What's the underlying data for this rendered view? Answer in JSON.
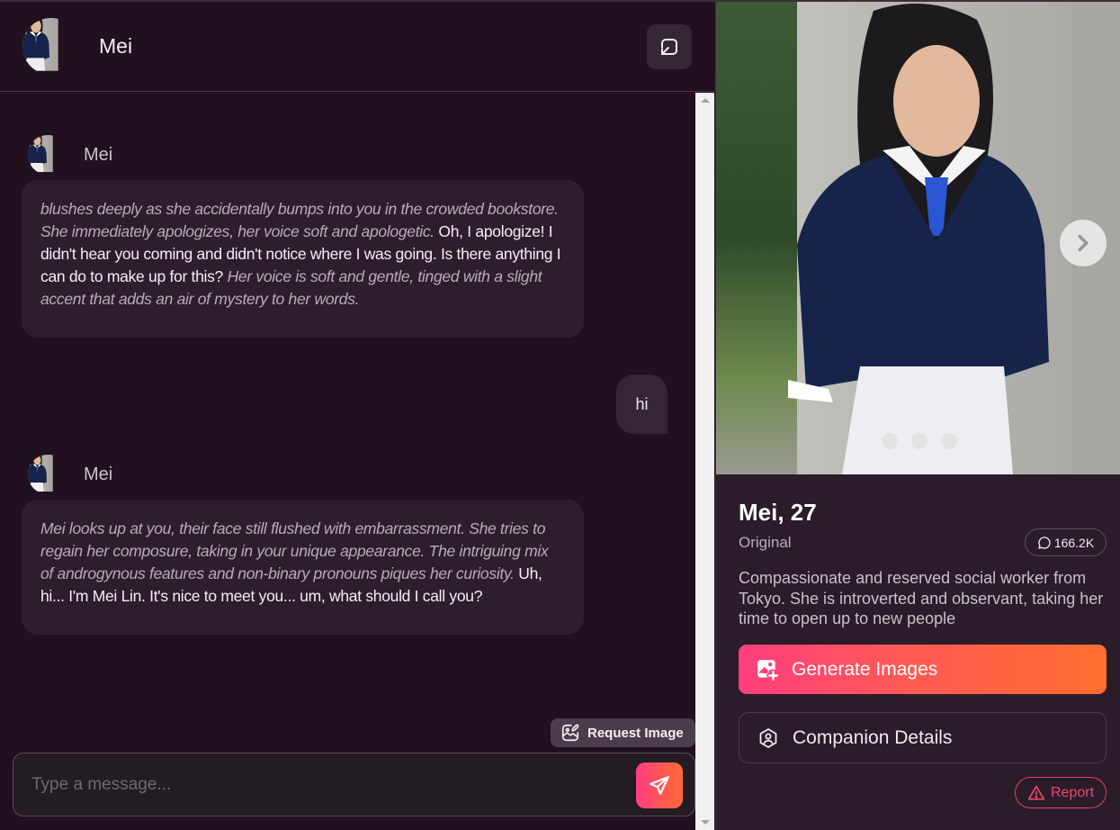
{
  "header": {
    "name": "Mei",
    "reset_icon": "reset-chat-icon"
  },
  "messages": [
    {
      "type": "ai",
      "sender": "Mei",
      "segments": [
        {
          "style": "action",
          "text": "blushes deeply as she accidentally bumps into you in the crowded bookstore. She immediately apologizes, her voice soft and apologetic."
        },
        {
          "style": "speech",
          "text": " Oh, I apologize! I didn't hear you coming and didn't notice where I was going. Is there anything I can do to make up for this? "
        },
        {
          "style": "action",
          "text": "Her voice is soft and gentle, tinged with a slight accent that adds an air of mystery to her words."
        }
      ]
    },
    {
      "type": "user",
      "text": "hi"
    },
    {
      "type": "ai",
      "sender": "Mei",
      "segments": [
        {
          "style": "action",
          "text": "Mei looks up at you, their face still flushed with embarrassment. She tries to regain her composure, taking in your unique appearance. The intriguing mix of androgynous features and non-binary pronouns piques her curiosity."
        },
        {
          "style": "speech",
          "text": " Uh, hi... I'm Mei Lin. It's nice to meet you... um, what should I call you?"
        }
      ]
    }
  ],
  "composer": {
    "placeholder": "Type a message...",
    "value": "",
    "request_image_label": "Request Image"
  },
  "profile": {
    "title": "Mei, 27",
    "subtitle": "Original",
    "chat_count": "166.2K",
    "description": "Compassionate and reserved social worker from Tokyo. She is introverted and observant, taking her time to open up to new people",
    "carousel_total": 3,
    "generate_label": "Generate Images",
    "details_label": "Companion Details",
    "report_label": "Report"
  },
  "colors": {
    "background": "#220f20",
    "panel": "#2b1c2a",
    "bubble": "#2e1e2d",
    "accent_start": "#ff3d7f",
    "accent_end": "#ff6d2f",
    "report": "#ea4b6a"
  }
}
